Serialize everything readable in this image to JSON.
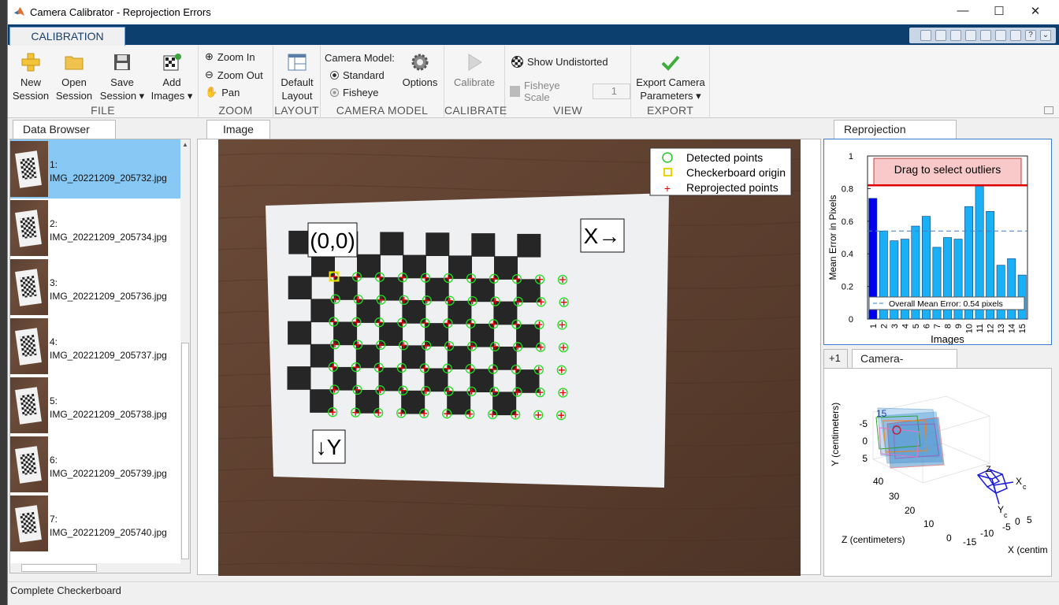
{
  "window": {
    "title": "Camera Calibrator - Reprojection Errors",
    "controls": [
      "—",
      "☐",
      "✕"
    ]
  },
  "ribbon_tab": "CALIBRATION",
  "file_group": {
    "label": "FILE",
    "new_session": [
      "New",
      "Session"
    ],
    "open_session": [
      "Open",
      "Session"
    ],
    "save_session": [
      "Save",
      "Session ▾"
    ],
    "add_images": [
      "Add",
      "Images ▾"
    ]
  },
  "zoom_group": {
    "label": "ZOOM",
    "zoom_in": "Zoom In",
    "zoom_out": "Zoom Out",
    "pan": "Pan"
  },
  "layout_group": {
    "label": "LAYOUT",
    "default_layout": [
      "Default",
      "Layout"
    ]
  },
  "camera_model_group": {
    "label": "CAMERA MODEL",
    "title": "Camera Model:",
    "standard": "Standard",
    "fisheye": "Fisheye",
    "options": "Options",
    "selected": "Standard"
  },
  "calibrate_group": {
    "label": "CALIBRATE",
    "calibrate": "Calibrate"
  },
  "view_group": {
    "label": "VIEW",
    "show_undistorted": "Show Undistorted",
    "fisheye_scale": "Fisheye Scale",
    "fisheye_scale_value": "1"
  },
  "export_group": {
    "label": "EXPORT",
    "export": [
      "Export Camera",
      "Parameters ▾"
    ]
  },
  "data_browser": {
    "tab": "Data Browser",
    "items": [
      {
        "index": "1:",
        "file": "IMG_20221209_205732.jpg",
        "selected": true
      },
      {
        "index": "2:",
        "file": "IMG_20221209_205734.jpg"
      },
      {
        "index": "3:",
        "file": "IMG_20221209_205736.jpg"
      },
      {
        "index": "4:",
        "file": "IMG_20221209_205737.jpg"
      },
      {
        "index": "5:",
        "file": "IMG_20221209_205738.jpg"
      },
      {
        "index": "6:",
        "file": "IMG_20221209_205739.jpg"
      },
      {
        "index": "7:",
        "file": "IMG_20221209_205740.jpg"
      }
    ]
  },
  "image_panel": {
    "tab": "Image",
    "legend": [
      "Detected points",
      "Checkerboard origin",
      "Reprojected points"
    ],
    "origin_label": "(0,0)",
    "x_label": "X→",
    "y_label": "↓Y"
  },
  "reprojection_panel": {
    "tab": "Reprojection Errors",
    "drag_label": "Drag to select outliers",
    "overall_label": "Overall Mean Error: 0.54 pixels"
  },
  "chart_data": {
    "type": "bar",
    "categories": [
      "1",
      "2",
      "3",
      "4",
      "5",
      "6",
      "7",
      "8",
      "9",
      "10",
      "11",
      "12",
      "13",
      "14",
      "15"
    ],
    "values": [
      0.74,
      0.54,
      0.48,
      0.49,
      0.57,
      0.63,
      0.44,
      0.5,
      0.49,
      0.69,
      0.82,
      0.66,
      0.33,
      0.37,
      0.27
    ],
    "selected_index": 0,
    "overall_mean": 0.54,
    "threshold": 0.82,
    "xlabel": "Images",
    "ylabel": "Mean Error in Pixels",
    "ylim": [
      0,
      1
    ],
    "yticks": [
      "0",
      "0.2",
      "0.4",
      "0.6",
      "0.8",
      "1"
    ],
    "colors": {
      "selected": "#0000ee",
      "bar": "#1ab0f5",
      "threshold": "#dd0000",
      "mean": "#3a7fbf"
    }
  },
  "camera_panel": {
    "extra_tab": "+1",
    "tab": "Camera-centric",
    "ylabel": "Y (centimeters)",
    "zlabel": "Z (centimeters)",
    "xlabel": "X (centim",
    "y_ticks": [
      "-5",
      "0",
      "5"
    ],
    "z_ticks": [
      "40",
      "30",
      "20",
      "10",
      "0"
    ],
    "x_ticks": [
      "-15",
      "-10",
      "-5",
      "0",
      "5"
    ],
    "cam_labels": [
      "Z",
      "X",
      "c",
      "Y",
      "c"
    ],
    "board_label": "15"
  },
  "status": "Complete Checkerboard"
}
